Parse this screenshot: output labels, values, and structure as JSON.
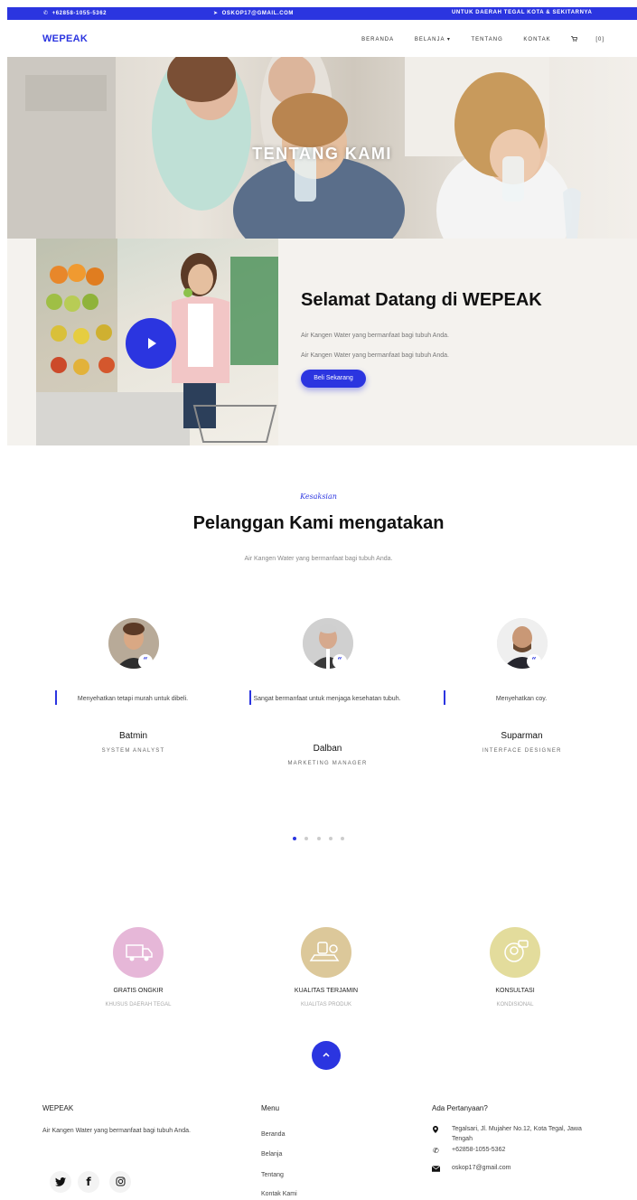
{
  "topbar": {
    "phone": "+62858-1055-5362",
    "email": "OSKOP17@GMAIL.COM",
    "area": "UNTUK DAERAH TEGAL KOTA & SEKITARNYA"
  },
  "nav": {
    "brand": "WEPEAK",
    "items": [
      "BERANDA",
      "BELANJA ▾",
      "TENTANG",
      "KONTAK"
    ],
    "cart": "[0]"
  },
  "hero": {
    "title": "TENTANG KAMI"
  },
  "welcome": {
    "heading": "Selamat Datang di WEPEAK",
    "para1": "Air Kangen Water yang bermanfaat bagi tubuh Anda.",
    "para2": "Air Kangen Water yang bermanfaat bagi tubuh Anda.",
    "button": "Beli Sekarang"
  },
  "testimonials": {
    "eyebrow": "Kesaksian",
    "title": "Pelanggan Kami mengatakan",
    "subtitle": "Air Kangen Water yang bermanfaat bagi tubuh Anda.",
    "items": [
      {
        "quote": "Menyehatkan tetapi murah untuk dibeli.",
        "name": "Batmin",
        "role": "SYSTEM ANALYST"
      },
      {
        "quote": "Sangat bermanfaat untuk menjaga kesehatan tubuh.",
        "name": "Dalban",
        "role": "MARKETING MANAGER"
      },
      {
        "quote": "Menyehatkan coy.",
        "name": "Suparman",
        "role": "INTERFACE DESIGNER"
      }
    ],
    "active_dot": 1,
    "dot_count": 5
  },
  "features": [
    {
      "title": "GRATIS ONGKIR",
      "sub": "KHUSUS DAERAH TEGAL",
      "color": "#e6b7d8",
      "icon": "truck-icon"
    },
    {
      "title": "KUALITAS TERJAMIN",
      "sub": "KUALITAS PRODUK",
      "color": "#dcc89a",
      "icon": "quality-icon"
    },
    {
      "title": "KONSULTASI",
      "sub": "KONDISIONAL",
      "color": "#e3dc9c",
      "icon": "consult-icon"
    }
  ],
  "footer": {
    "brand": "WEPEAK",
    "about": "Air Kangen Water yang bermanfaat bagi tubuh Anda.",
    "menu_title": "Menu",
    "menu": [
      "Beranda",
      "Belanja",
      "Tentang",
      "Kontak Kami"
    ],
    "contact_title": "Ada Pertanyaan?",
    "address_line1": "Tegalsari, Jl. Mujaher No.12, Kota Tegal, Jawa",
    "address_line2": "Tengah",
    "phone": "+62858-1055-5362",
    "email": "oskop17@gmail.com"
  },
  "colors": {
    "primary": "#2b35e0"
  }
}
